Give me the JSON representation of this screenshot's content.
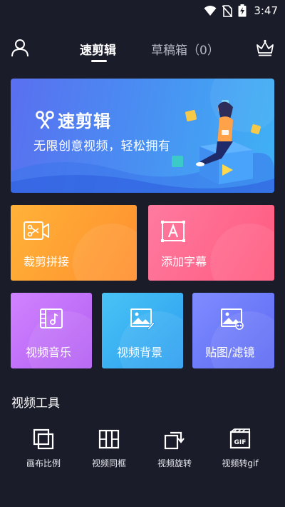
{
  "status_bar": {
    "time": "3:47"
  },
  "header": {
    "tabs": [
      {
        "label": "速剪辑",
        "active": true
      },
      {
        "label": "草稿箱（0）",
        "active": false
      }
    ]
  },
  "banner": {
    "brand": "速剪辑",
    "slogan": "无限创意视频，轻松拥有"
  },
  "features": [
    {
      "label": "裁剪拼接",
      "icon": "scissors-video-icon"
    },
    {
      "label": "添加字幕",
      "icon": "text-frame-icon"
    },
    {
      "label": "视频音乐",
      "icon": "film-music-icon"
    },
    {
      "label": "视频背景",
      "icon": "image-brush-icon"
    },
    {
      "label": "贴图/滤镜",
      "icon": "image-filter-icon"
    }
  ],
  "section": {
    "title": "视频工具"
  },
  "tools": [
    {
      "label": "画布比例",
      "icon": "canvas-ratio-icon"
    },
    {
      "label": "视频同框",
      "icon": "split-frame-icon"
    },
    {
      "label": "视频旋转",
      "icon": "rotate-icon"
    },
    {
      "label": "视频转gif",
      "icon": "gif-icon"
    }
  ],
  "colors": {
    "background": "#1b1c29",
    "card_cut": "#ffa534",
    "card_subtitle": "#ff6b8f",
    "card_music": "#c26ff8",
    "card_background": "#3ab0f3",
    "card_sticker": "#6e7bf8"
  }
}
